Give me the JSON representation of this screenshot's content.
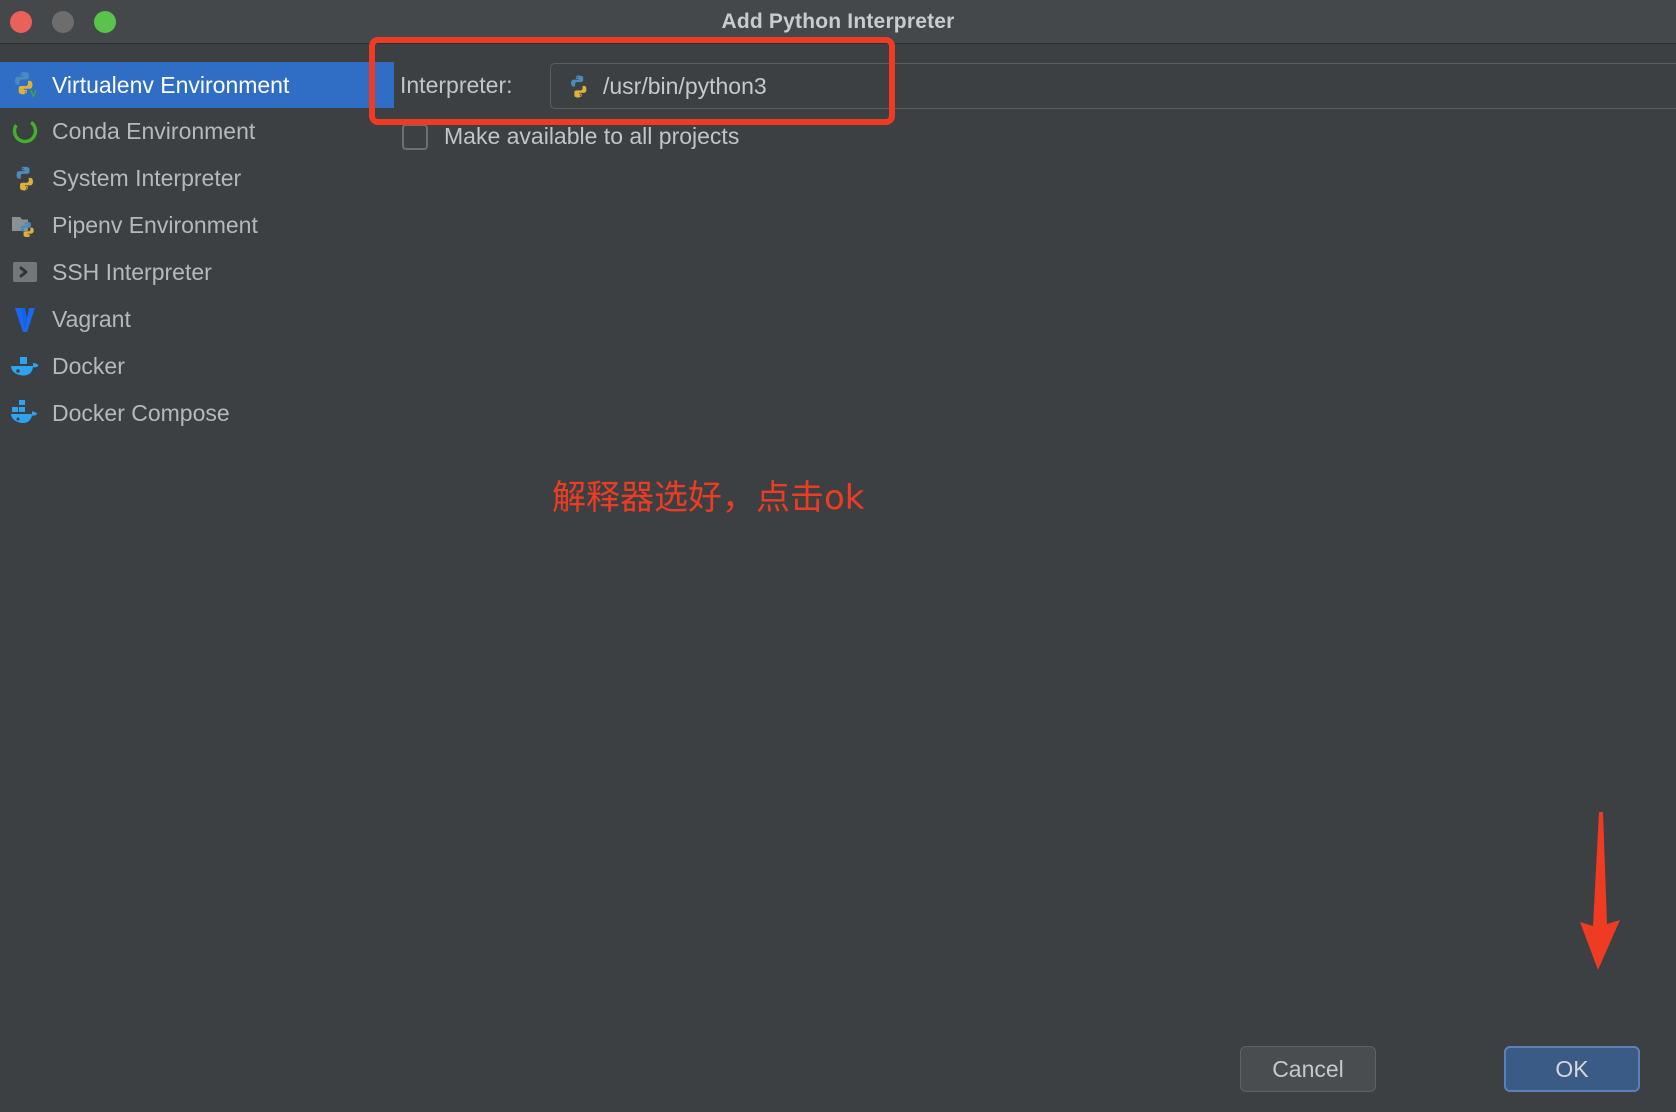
{
  "window": {
    "title": "Add Python Interpreter",
    "controls": {
      "close": "close-button",
      "minimize": "minimize-button",
      "maximize": "maximize-button"
    }
  },
  "sidebar": {
    "items": [
      {
        "label": "Virtualenv Environment",
        "icon": "python-venv-icon",
        "selected": true
      },
      {
        "label": "Conda Environment",
        "icon": "conda-icon",
        "selected": false
      },
      {
        "label": "System Interpreter",
        "icon": "python-icon",
        "selected": false
      },
      {
        "label": "Pipenv Environment",
        "icon": "pipenv-icon",
        "selected": false
      },
      {
        "label": "SSH Interpreter",
        "icon": "ssh-terminal-icon",
        "selected": false
      },
      {
        "label": "Vagrant",
        "icon": "vagrant-icon",
        "selected": false
      },
      {
        "label": "Docker",
        "icon": "docker-icon",
        "selected": false
      },
      {
        "label": "Docker Compose",
        "icon": "docker-compose-icon",
        "selected": false
      }
    ]
  },
  "main": {
    "interpreter_label": "Interpreter:",
    "interpreter_value": "/usr/bin/python3",
    "interpreter_icon": "python-icon",
    "dropdown_icon": "chevron-down-icon",
    "browse_button_label": "...",
    "checkbox_label": "Make available to all projects",
    "checkbox_checked": false
  },
  "annotations": {
    "highlight_box": "red-highlight-rectangle",
    "note_text": "解释器选好，点击ok",
    "arrow": "red-down-arrow",
    "color": "#ee3b22"
  },
  "footer": {
    "cancel_label": "Cancel",
    "ok_label": "OK"
  },
  "colors": {
    "background": "#3c4043",
    "titlebar": "#45484b",
    "selection": "#2f6ec4",
    "accent_red": "#ee3b22",
    "ok_button": "#3a5b85"
  }
}
